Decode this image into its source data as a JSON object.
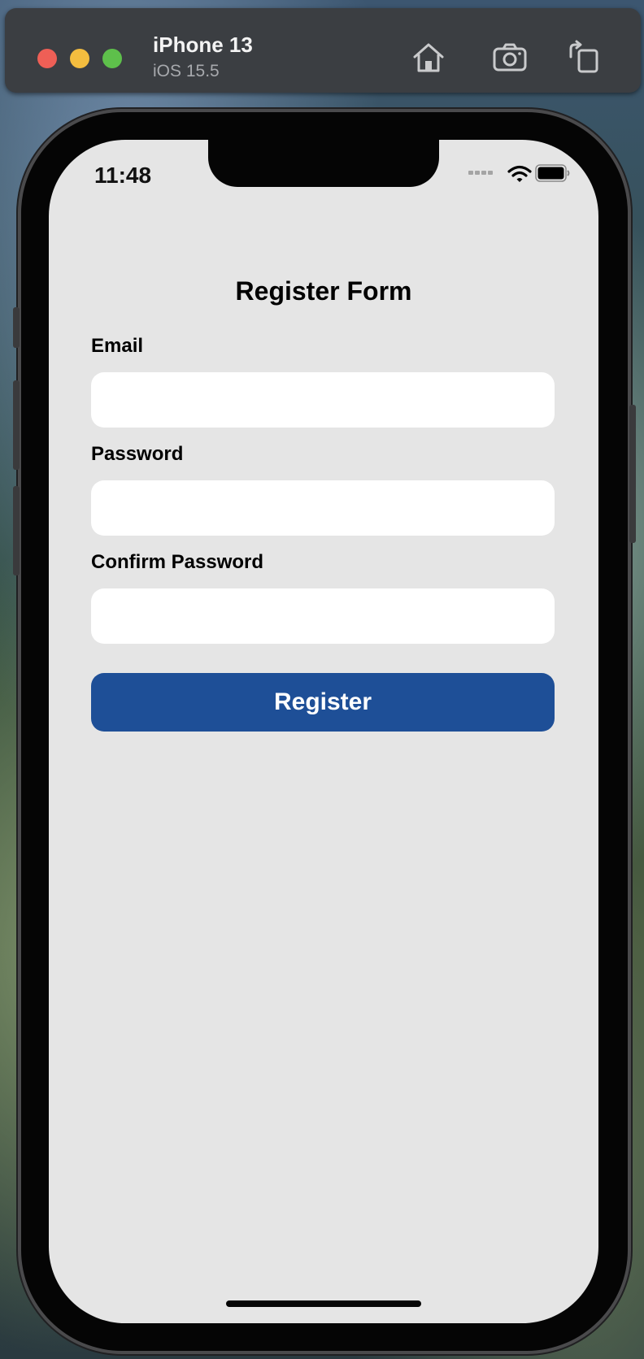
{
  "simulator": {
    "device_name": "iPhone 13",
    "os_version": "iOS 15.5",
    "toolbar_icons": [
      "home-icon",
      "screenshot-icon",
      "rotate-icon"
    ],
    "window_controls": {
      "close": "#ee5f56",
      "minimize": "#f4bd3f",
      "zoom": "#5ec04b"
    }
  },
  "status_bar": {
    "time": "11:48",
    "icons": [
      "cellular-icon",
      "wifi-icon",
      "battery-icon"
    ]
  },
  "form": {
    "title": "Register Form",
    "fields": [
      {
        "label": "Email",
        "value": "",
        "placeholder": ""
      },
      {
        "label": "Password",
        "value": "",
        "placeholder": ""
      },
      {
        "label": "Confirm Password",
        "value": "",
        "placeholder": ""
      }
    ],
    "submit_label": "Register"
  },
  "colors": {
    "screen_background": "#e5e5e5",
    "input_background": "#ffffff",
    "button_background": "#1e4f97",
    "button_text": "#ffffff"
  }
}
